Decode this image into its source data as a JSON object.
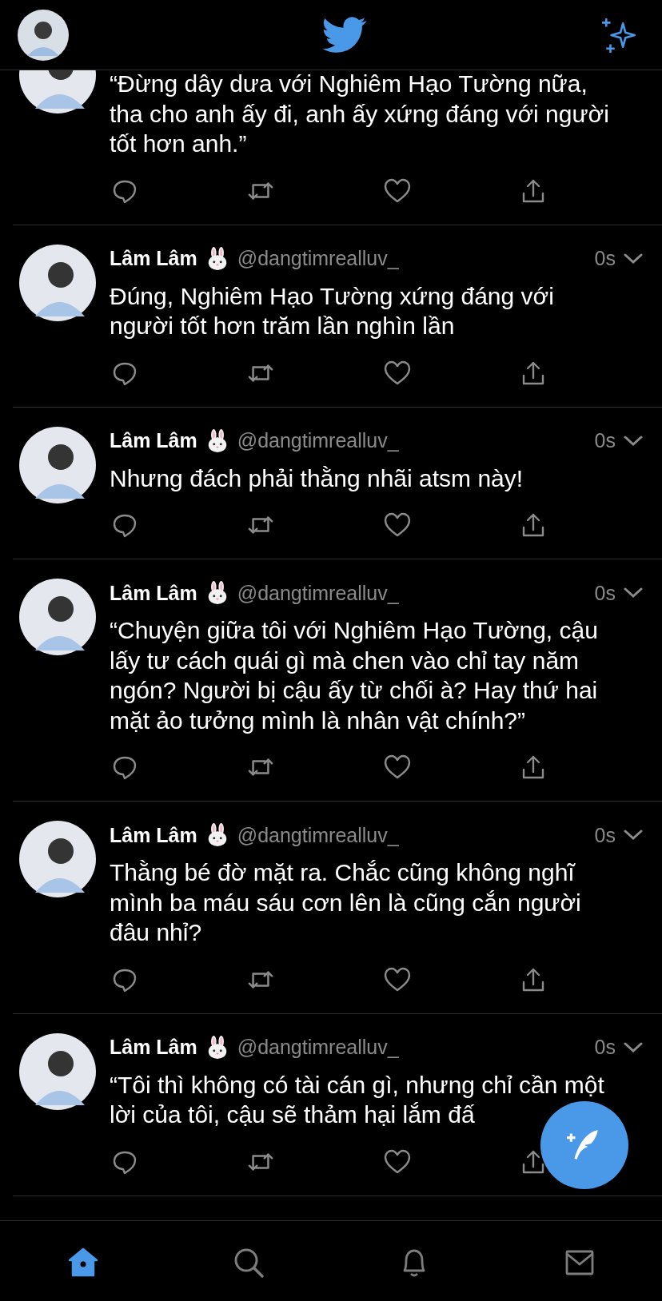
{
  "tweets": [
    {
      "text": "“Đừng dây dưa với Nghiêm Hạo Tường nữa, tha cho anh ấy đi, anh ấy xứng đáng với người tốt hơn anh.”"
    },
    {
      "name": "Lâm Lâm",
      "handle": "@dangtimrealluv_",
      "time": "0s",
      "text": "Đúng, Nghiêm Hạo Tường xứng đáng với người tốt hơn trăm lần nghìn lần"
    },
    {
      "name": "Lâm Lâm",
      "handle": "@dangtimrealluv_",
      "time": "0s",
      "text": "Nhưng đách phải thằng nhãi atsm này!"
    },
    {
      "name": "Lâm Lâm",
      "handle": "@dangtimrealluv_",
      "time": "0s",
      "text": "“Chuyện giữa tôi với Nghiêm Hạo Tường, cậu lấy tư cách quái gì mà chen vào chỉ tay năm ngón? Người bị cậu ấy từ chối à? Hay thứ hai mặt ảo tưởng mình là nhân vật chính?”"
    },
    {
      "name": "Lâm Lâm",
      "handle": "@dangtimrealluv_",
      "time": "0s",
      "text": "Thằng bé đờ mặt ra. Chắc cũng không nghĩ mình ba máu sáu cơn lên là cũng cắn người đâu nhỉ?"
    },
    {
      "name": "Lâm Lâm",
      "handle": "@dangtimrealluv_",
      "time": "0s",
      "text": "“Tôi thì không có tài cán gì, nhưng chỉ cần một lời của tôi, cậu sẽ thảm hại lắm đấ"
    }
  ],
  "tabs": [
    {
      "kind": "home",
      "selected": true
    },
    {
      "kind": "search",
      "selected": false
    },
    {
      "kind": "notifications",
      "selected": false
    },
    {
      "kind": "messages",
      "selected": false
    }
  ]
}
